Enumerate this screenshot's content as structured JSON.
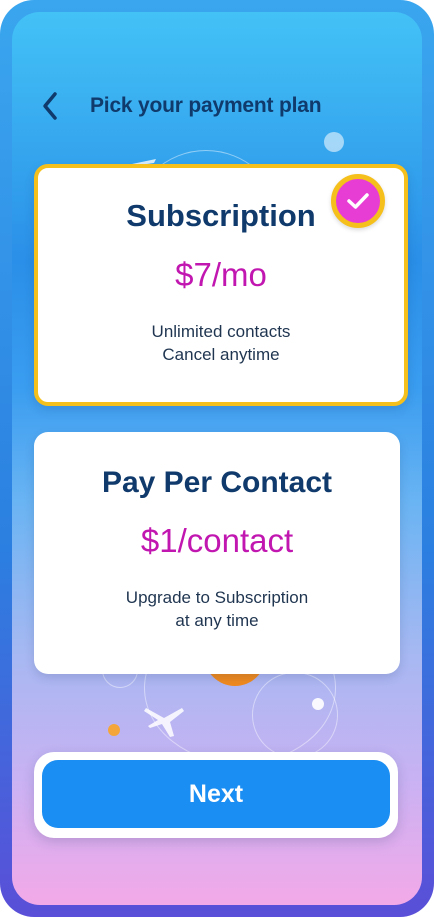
{
  "header": {
    "back_icon": "chevron-left-icon",
    "title": "Pick your payment plan"
  },
  "plans": [
    {
      "name": "Subscription",
      "price": "$7/mo",
      "desc_line1": "Unlimited contacts",
      "desc_line2": "Cancel anytime",
      "selected": true
    },
    {
      "name": "Pay Per Contact",
      "price": "$1/contact",
      "desc_line1": "Upgrade to Subscription",
      "desc_line2": "at any time",
      "selected": false
    }
  ],
  "selected_icon": "check-icon",
  "next_button": {
    "label": "Next"
  },
  "colors": {
    "title": "#0f3a6b",
    "price": "#c117b0",
    "selected_border": "#f5bf1c",
    "check_bg": "#e73dd4",
    "button": "#1a8ef2"
  }
}
